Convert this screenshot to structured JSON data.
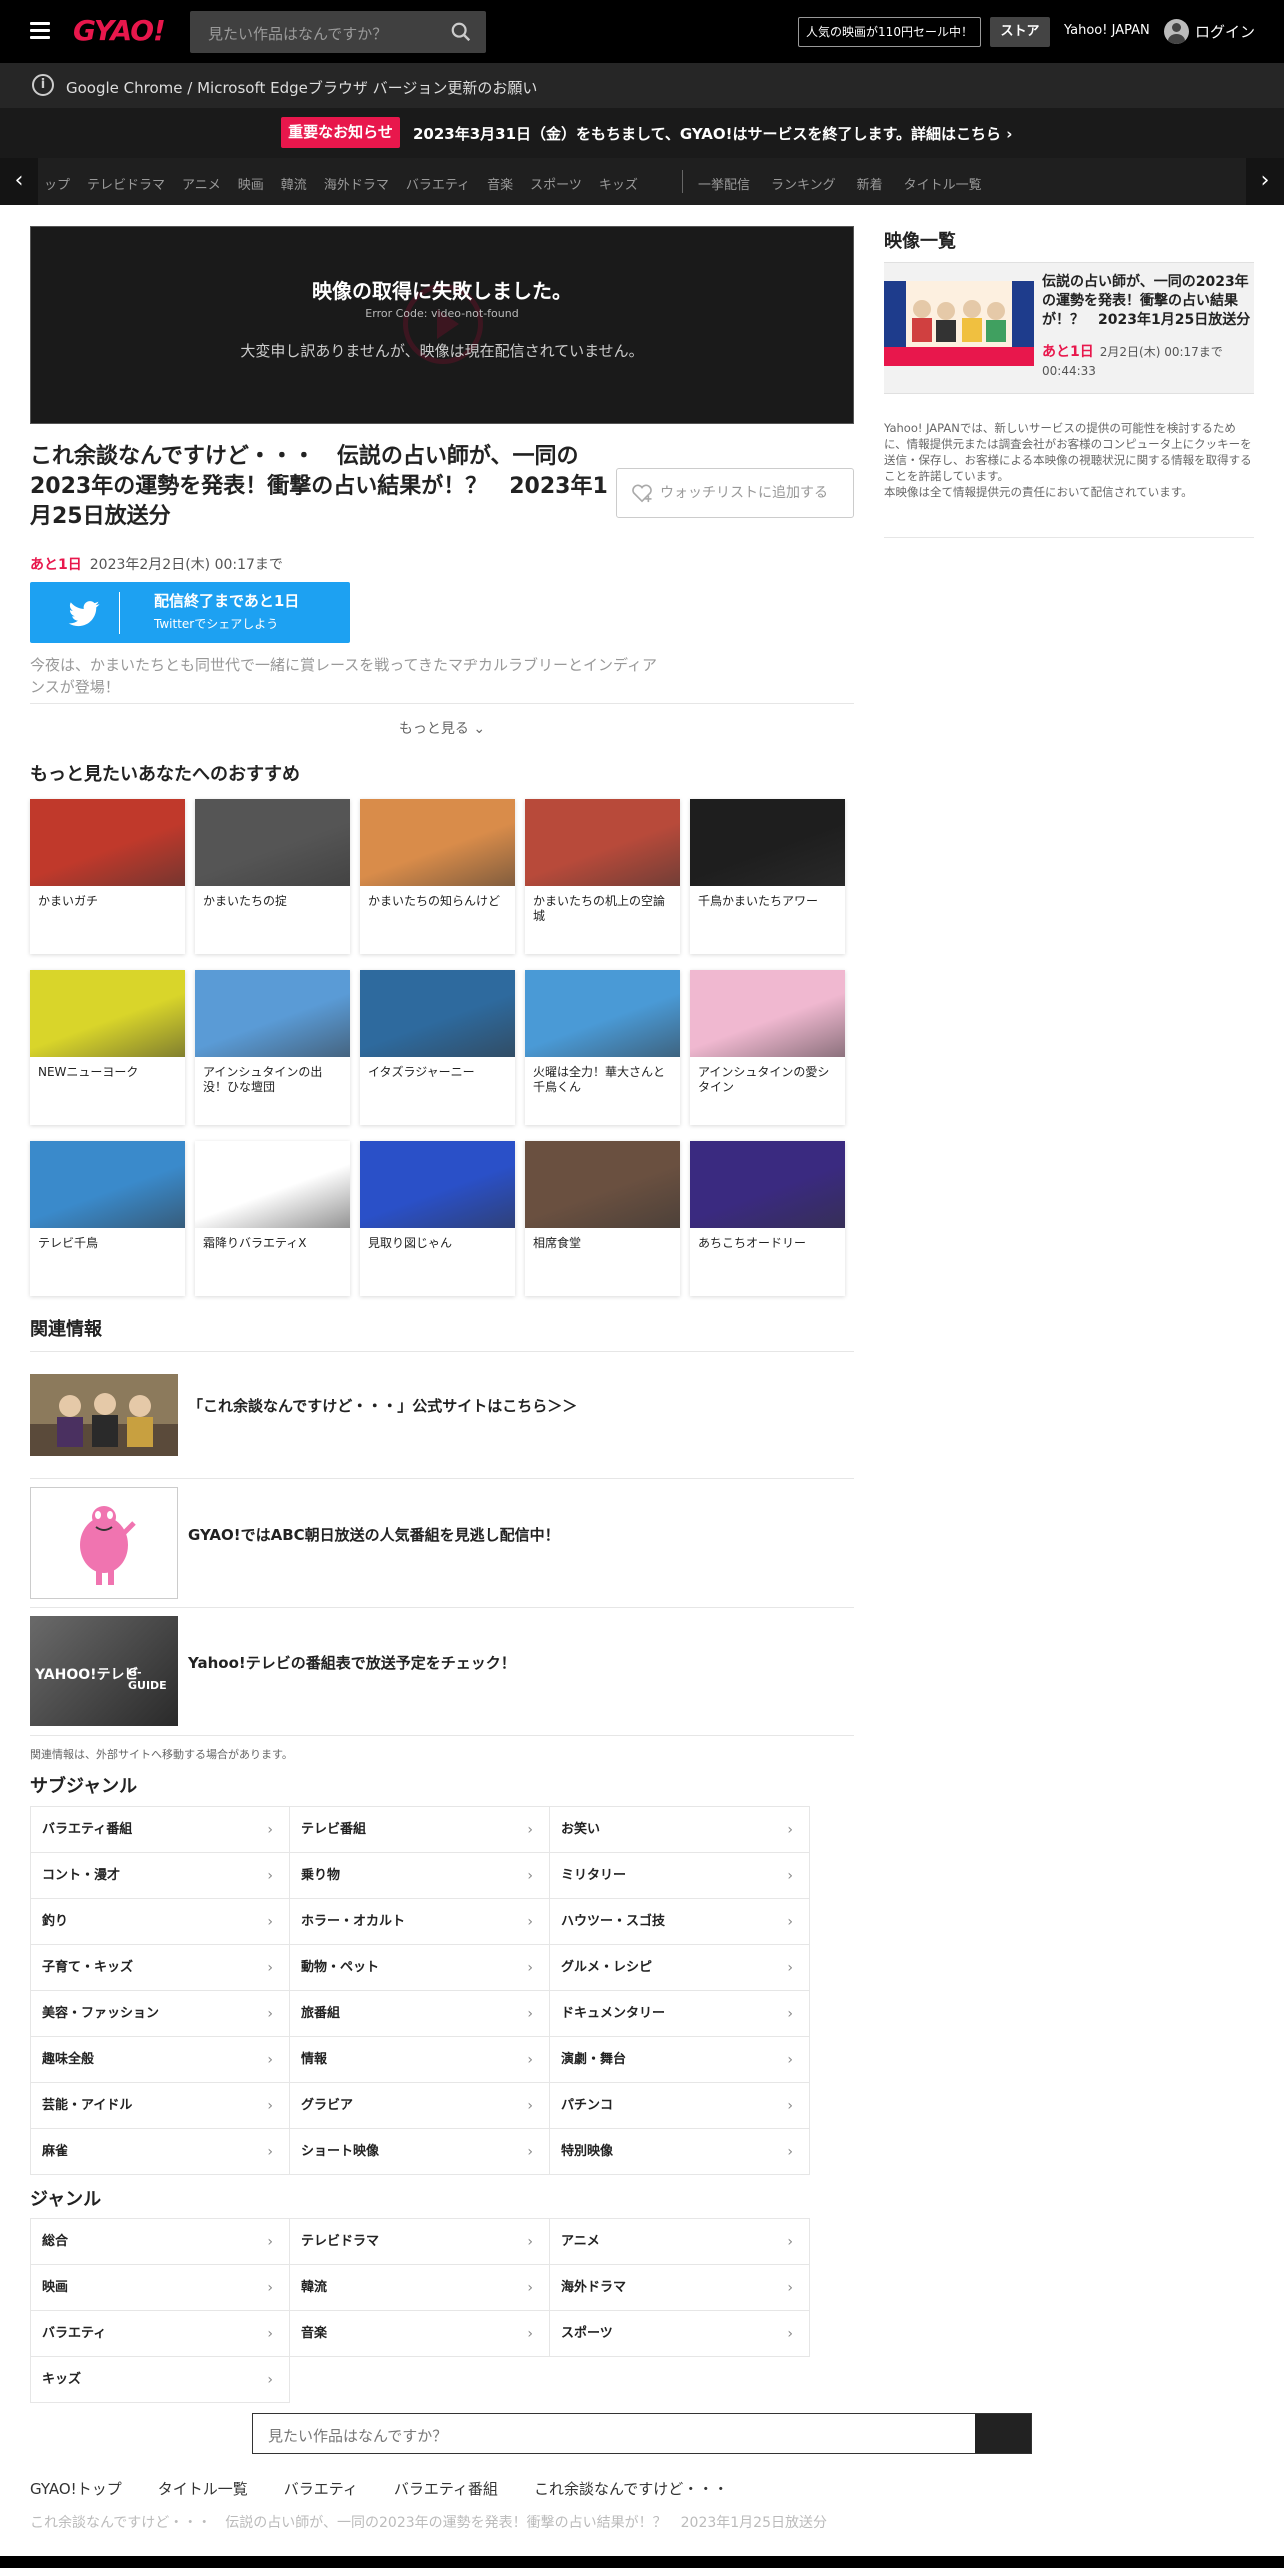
{
  "header": {
    "logo": "GYAO!",
    "search_placeholder": "見たい作品はなんですか？",
    "promo": "人気の映画が110円セール中！",
    "store": "ストア",
    "yahoo": "Yahoo! JAPAN",
    "login": "ログイン"
  },
  "browser_notice": "Google Chrome / Microsoft Edgeブラウザ バージョン更新のお願い",
  "announce": {
    "badge": "重要なお知らせ",
    "text": "2023年3月31日（金）をもちまして、GYAO!はサービスを終了します。詳細はこちら"
  },
  "catnav": {
    "items": [
      "ップ",
      "テレビドラマ",
      "アニメ",
      "映画",
      "韓流",
      "海外ドラマ",
      "バラエティ",
      "音楽",
      "スポーツ",
      "キッズ"
    ],
    "items2": [
      "一挙配信",
      "ランキング",
      "新着",
      "タイトル一覧"
    ]
  },
  "player": {
    "error_title": "映像の取得に失敗しました。",
    "error_code": "Error Code: video-not-found",
    "error_msg": "大変申し訳ありませんが、映像は現在配信されていません。"
  },
  "episode": {
    "title": "これ余談なんですけど・・・　伝説の占い師が、一同の2023年の運勢を発表！衝撃の占い結果が！？　2023年1月25日放送分",
    "watchlist": "ウォッチリストに追加する",
    "remain_badge": "あと1日",
    "remain_date": "2023年2月2日(木) 00:17まで",
    "twitter_l1": "配信終了まであと1日",
    "twitter_l2": "Twitterでシェアしよう",
    "description": "今夜は、かまいたちとも同世代で一緒に賞レースを戦ってきたマヂカルラブリーとインディアンスが登場！",
    "more": "もっと見る"
  },
  "recommend": {
    "title": "もっと見たいあなたへのおすすめ",
    "items": [
      {
        "label": "かまいガチ",
        "color": "#c0392b"
      },
      {
        "label": "かまいたちの掟",
        "color": "#555555"
      },
      {
        "label": "かまいたちの知らんけど",
        "color": "#d98c4a"
      },
      {
        "label": "かまいたちの机上の空論城",
        "color": "#b84a3a"
      },
      {
        "label": "千鳥かまいたちアワー",
        "color": "#1e1e1e"
      },
      {
        "label": "NEWニューヨーク",
        "color": "#d9d52a"
      },
      {
        "label": "アインシュタインの出没！ひな壇団",
        "color": "#5a9bd6"
      },
      {
        "label": "イタズラジャーニー",
        "color": "#2e6a9e"
      },
      {
        "label": "火曜は全力！華大さんと千鳥くん",
        "color": "#4a9ad6"
      },
      {
        "label": "アインシュタインの愛シタイン",
        "color": "#f0b8d0"
      },
      {
        "label": "テレビ千鳥",
        "color": "#3a8acb"
      },
      {
        "label": "霜降りバラエティX",
        "color": "#ffffff"
      },
      {
        "label": "見取り図じゃん",
        "color": "#2a50c8"
      },
      {
        "label": "相席食堂",
        "color": "#6a5040"
      },
      {
        "label": "あちこちオードリー",
        "color": "#3a2a80"
      }
    ]
  },
  "related": {
    "title": "関連情報",
    "items": [
      "「これ余談なんですけど・・・」公式サイトはこちら＞＞",
      "GYAO!ではABC朝日放送の人気番組を見逃し配信中！",
      "Yahoo!テレビの番組表で放送予定をチェック！"
    ],
    "yahoo_tv_logo": "YAHOO!テレビ",
    "gguide_logo": "G-GUIDE",
    "note": "関連情報は、外部サイトへ移動する場合があります。"
  },
  "subgenre": {
    "title": "サブジャンル",
    "items": [
      "バラエティ番組",
      "テレビ番組",
      "お笑い",
      "コント・漫才",
      "乗り物",
      "ミリタリー",
      "釣り",
      "ホラー・オカルト",
      "ハウツー・スゴ技",
      "子育て・キッズ",
      "動物・ペット",
      "グルメ・レシピ",
      "美容・ファッション",
      "旅番組",
      "ドキュメンタリー",
      "趣味全般",
      "情報",
      "演劇・舞台",
      "芸能・アイドル",
      "グラビア",
      "パチンコ",
      "麻雀",
      "ショート映像",
      "特別映像"
    ]
  },
  "genre": {
    "title": "ジャンル",
    "items": [
      "総合",
      "テレビドラマ",
      "アニメ",
      "映画",
      "韓流",
      "海外ドラマ",
      "バラエティ",
      "音楽",
      "スポーツ",
      "キッズ"
    ]
  },
  "bottom_search": {
    "placeholder": "見たい作品はなんですか？"
  },
  "breadcrumb": [
    "GYAO!トップ",
    "タイトル一覧",
    "バラエティ",
    "バラエティ番組",
    "これ余談なんですけど・・・"
  ],
  "subcrumb": "これ余談なんですけど・・・　伝説の占い師が、一同の2023年の運勢を発表！衝撃の占い結果が！？　2023年1月25日放送分",
  "sidebar": {
    "title": "映像一覧",
    "card_title": "伝説の占い師が、一同の2023年の運勢を発表！衝撃の占い結果が！？　2023年1月25日放送分",
    "card_badge": "あと1日",
    "card_date": "2月2日(木) 00:17まで",
    "card_duration": "00:44:33",
    "note": "Yahoo! JAPANでは、新しいサービスの提供の可能性を検討するために、情報提供元または調査会社がお客様のコンピュータ上にクッキーを送信・保存し、お客様による本映像の視聴状況に関する情報を取得することを許諾しています。",
    "note2": "本映像は全て情報提供元の責任において配信されています。"
  },
  "colors": {
    "brand": "#e8174c",
    "twitter": "#1da1f2"
  }
}
